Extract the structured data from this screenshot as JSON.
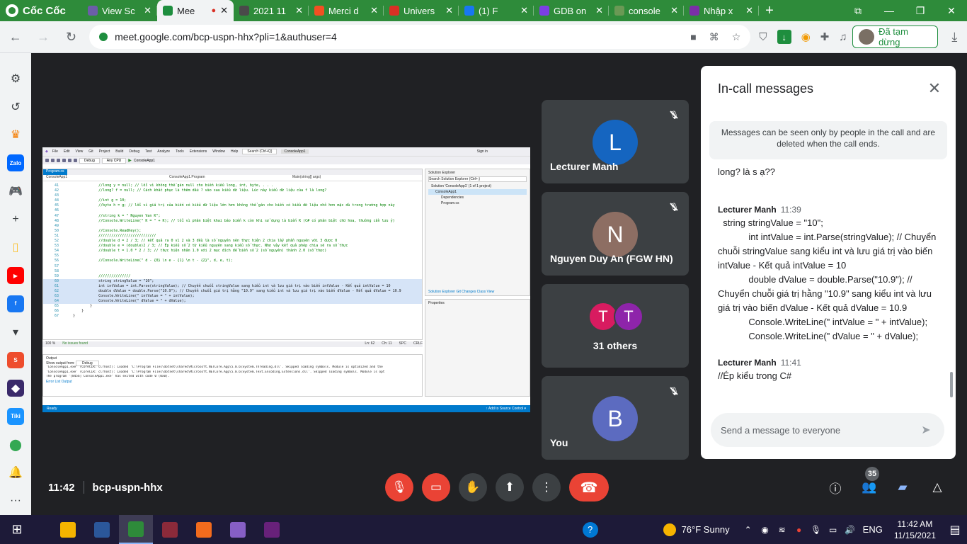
{
  "browser": {
    "brand": "Cốc Cốc",
    "tabs": [
      {
        "title": "View Sc",
        "color": "#6b5ea8"
      },
      {
        "title": "Mee",
        "color": "#1e8e3e",
        "active": true
      },
      {
        "title": "2021 11",
        "color": "#4a4a4a"
      },
      {
        "title": "Merci d",
        "color": "#f25022"
      },
      {
        "title": "Univers",
        "color": "#d93025"
      },
      {
        "title": "(1) F",
        "color": "#1877f2"
      },
      {
        "title": "GDB on",
        "color": "#7b3fe4"
      },
      {
        "title": "console",
        "color": "#6a9955"
      },
      {
        "title": "Nhập x",
        "color": "#7b2fa8"
      }
    ],
    "url": "meet.google.com/bcp-uspn-hhx?pli=1&authuser=4",
    "profile_label": "Đã tạm dừng"
  },
  "sidebar": {
    "items": [
      {
        "icon": "gear-icon",
        "glyph": "⚙"
      },
      {
        "icon": "history-icon",
        "glyph": "↺"
      },
      {
        "icon": "crown-icon",
        "glyph": "♛"
      },
      {
        "icon": "zalo-icon",
        "glyph": "Zalo"
      },
      {
        "icon": "gamepad-icon",
        "glyph": "🎮"
      },
      {
        "icon": "add-icon",
        "glyph": "+"
      },
      {
        "icon": "notes-icon",
        "glyph": "▯"
      },
      {
        "icon": "youtube-icon",
        "glyph": "▶"
      },
      {
        "icon": "facebook-icon",
        "glyph": "f"
      },
      {
        "icon": "more-down-icon",
        "glyph": "▾"
      },
      {
        "icon": "shopee-icon",
        "glyph": "S"
      },
      {
        "icon": "game-avatar-icon",
        "glyph": "◆"
      },
      {
        "icon": "tiki-icon",
        "glyph": "Tiki"
      },
      {
        "icon": "map-pin-icon",
        "glyph": "⬤"
      },
      {
        "icon": "bell-icon",
        "glyph": "🔔"
      },
      {
        "icon": "ellipsis-icon",
        "glyph": "···"
      }
    ]
  },
  "meeting": {
    "time": "11:42",
    "code": "bcp-uspn-hhx",
    "participant_count": "35",
    "tiles": [
      {
        "name": "Lecturer Manh",
        "initial": "L",
        "color": "#1565c0",
        "muted": true
      },
      {
        "name": "Nguyen Duy An (FGW HN)",
        "initial": "N",
        "color": "#8d6e63",
        "muted": true
      },
      {
        "name": "31 others",
        "initials": [
          "T",
          "T"
        ],
        "colors": [
          "#d81b60",
          "#8e24aa"
        ]
      },
      {
        "name": "You",
        "initial": "B",
        "color": "#5c6bc0",
        "muted": true
      }
    ]
  },
  "chat": {
    "title": "In-call messages",
    "info": "Messages can be seen only by people in the call and are deleted when the call ends.",
    "messages": [
      {
        "author": "",
        "time": "",
        "text": "long? là s ạ??"
      },
      {
        "author": "Lecturer Manh",
        "time": "11:39",
        "text": "  string stringValue = \"10\";\n            int intValue = int.Parse(stringValue); // Chuyển chuỗi stringValue sang kiểu int và lưu giá trị vào biến intValue - Kết quả intValue = 10\n            double dValue = double.Parse(\"10.9\"); // Chuyển chuỗi giá trị hằng \"10.9\" sang kiểu int và lưu giá trị vào biến dValue - Kết quả dValue = 10.9\n            Console.WriteLine(\" intValue = \" + intValue);\n            Console.WriteLine(\" dValue = \" + dValue);"
      },
      {
        "author": "Lecturer Manh",
        "time": "11:41",
        "text": "//Ép kiểu trong C#"
      }
    ],
    "input_placeholder": "Send a message to everyone"
  },
  "screen_share": {
    "search_placeholder": "Search (Ctrl+Q)",
    "app_name": "ConsoleApp1",
    "menu": [
      "File",
      "Edit",
      "View",
      "Git",
      "Project",
      "Build",
      "Debug",
      "Test",
      "Analyze",
      "Tools",
      "Extensions",
      "Window",
      "Help"
    ],
    "sign_in": "Sign in",
    "config": "Debug",
    "platform": "Any CPU",
    "run_label": "ConsoleApp1",
    "tab": "Program.cs",
    "nav_left": "ConsoleApp1",
    "nav_mid": "ConsoleApp1.Program",
    "nav_right": "Main(string[] args)",
    "code_lines": [
      {
        "n": "41",
        "t": "                //long y = null; // lỗi vì không thể gán null cho biến kiểu long, int, byte, . . ."
      },
      {
        "n": "42",
        "t": "                //long? f = null; // Cách khắc phục là thêm dấu ? vào sau kiểu dữ liệu. Lúc này kiểu dữ liệu của f là long?"
      },
      {
        "n": "43",
        "t": ""
      },
      {
        "n": "44",
        "t": "                //int g = 10;"
      },
      {
        "n": "45",
        "t": "                //byte h = g; // lỗi vì giá trị của biến có kiểu dữ liệu lớn hơn không thể gán cho biến có kiểu dữ liệu nhỏ hơn mặc dù trong trường hợp này"
      },
      {
        "n": "46",
        "t": ""
      },
      {
        "n": "47",
        "t": "                //string k = \" Nguyen Van K\";"
      },
      {
        "n": "48",
        "t": "                //Console.WriteLine(\" K = \" + K); // lỗi vì phân biệt khai báo biến k còn khi sử dụng là biến K (C# có phân biệt chữ hoa, thường cần lưu ý)"
      },
      {
        "n": "49",
        "t": ""
      },
      {
        "n": "50",
        "t": "                //Console.ReadKey();"
      },
      {
        "n": "51",
        "t": "                ///////////////////////////"
      },
      {
        "n": "52",
        "t": "                //double d = 2 / 3; // kết quả ra 0 vì 2 và 3 đều là số nguyên nên thực hiện 2 chia lấy phần nguyên với 3 được 0"
      },
      {
        "n": "53",
        "t": "                //double e = (double)2 / 3; // Ép kiểu số 2 từ kiểu nguyên sang kiểu số thực. Như vậy kết quả phép chia sẽ ra số thực"
      },
      {
        "n": "54",
        "t": "                //double t = 1.0 * 2 / 3; // thực hiện nhân 1.0 với 2 mục đích để biến số 2 (số nguyên) thành 2.0 (số thực)"
      },
      {
        "n": "55",
        "t": ""
      },
      {
        "n": "56",
        "t": "                //Console.WriteLine(\" d - {0} \\n e - {1} \\n t - {2}\", d, e, t);"
      },
      {
        "n": "57",
        "t": ""
      },
      {
        "n": "58",
        "t": ""
      },
      {
        "n": "59",
        "t": "                ///////////////"
      },
      {
        "n": "60",
        "t": "                string stringValue = \"10\";",
        "hl": true,
        "code": true
      },
      {
        "n": "61",
        "t": "                int intValue = int.Parse(stringValue); // Chuyển chuỗi stringValue sang kiểu int và lưu giá trị vào biến intValue - Kết quả intValue = 10",
        "hl": true,
        "code": true
      },
      {
        "n": "62",
        "t": "                double dValue = double.Parse(\"10.9\"); // Chuyển chuỗi giá trị hằng \"10.9\" sang kiểu int và lưu giá trị vào biến dValue - Kết quả dValue = 10.9",
        "hl": true,
        "code": true
      },
      {
        "n": "63",
        "t": "                Console.WriteLine(\" intValue = \" + intValue);",
        "hl": true,
        "code": true
      },
      {
        "n": "64",
        "t": "                Console.WriteLine(\" dValue = \" + dValue);",
        "hl": true,
        "code": true
      },
      {
        "n": "65",
        "t": "            }",
        "code": true
      },
      {
        "n": "66",
        "t": "        }",
        "code": true
      },
      {
        "n": "67",
        "t": "    }",
        "code": true
      }
    ],
    "status_zoom": "100 %",
    "status_issues": "No issues found",
    "status_ln": "Ln: 62",
    "status_ch": "Ch: 11",
    "status_spc": "SPC",
    "status_crlf": "CRLF",
    "output_title": "Output",
    "output_from": "Show output from:",
    "output_source": "Debug",
    "output_lines": [
      "'ConsoleApp1.exe' (CoreCLR: clrhost): Loaded 'C:\\Program Files\\dotnet\\shared\\Microsoft.NETCore.App\\5.0.6\\System.Threading.dll'. Skipped loading symbols. Module is optimized and the",
      "'ConsoleApp1.exe' (CoreCLR: clrhost): Loaded 'C:\\Program Files\\dotnet\\shared\\Microsoft.NETCore.App\\5.0.6\\System.Text.Encoding.Extensions.dll'. Skipped loading symbols. Module is opt",
      "The program '[8456] ConsoleApp1.exe' has exited with code 0 (0x0)."
    ],
    "output_tabs": "Error List   Output",
    "solution_title": "Solution Explorer",
    "solution_search": "Search Solution Explorer (Ctrl+;)",
    "solution_rows": [
      "Solution 'ConsoleApp1' (1 of 1 project)",
      "ConsoleApp1",
      "Dependencies",
      "Program.cs"
    ],
    "solution_tabs": "Solution Explorer   Git Changes   Class View",
    "props_title": "Properties",
    "statusbar_left": "Ready",
    "statusbar_right": "↑ Add to Source Control ▾"
  },
  "taskbar": {
    "weather": "76°F  Sunny",
    "lang": "ENG",
    "time": "11:42 AM",
    "date": "11/15/2021",
    "apps": [
      {
        "name": "file-explorer",
        "color": "#f4b400"
      },
      {
        "name": "word",
        "color": "#2b579a"
      },
      {
        "name": "coccoc",
        "color": "#2e8b3a",
        "active": true
      },
      {
        "name": "winrar",
        "color": "#8b2a3a"
      },
      {
        "name": "foxit-pdf",
        "color": "#f26b1d"
      },
      {
        "name": "visual-studio",
        "color": "#865fc5"
      },
      {
        "name": "visual-studio-2",
        "color": "#68217a"
      }
    ]
  }
}
